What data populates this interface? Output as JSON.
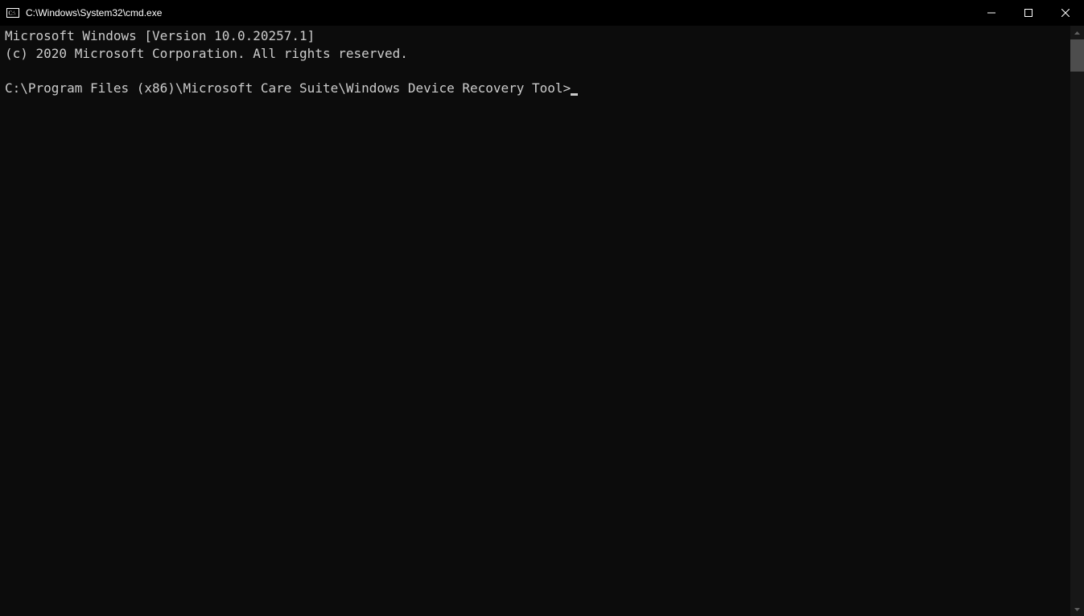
{
  "titlebar": {
    "title": "C:\\Windows\\System32\\cmd.exe"
  },
  "terminal": {
    "line1": "Microsoft Windows [Version 10.0.20257.1]",
    "line2": "(c) 2020 Microsoft Corporation. All rights reserved.",
    "blank": "",
    "prompt": "C:\\Program Files (x86)\\Microsoft Care Suite\\Windows Device Recovery Tool>"
  }
}
